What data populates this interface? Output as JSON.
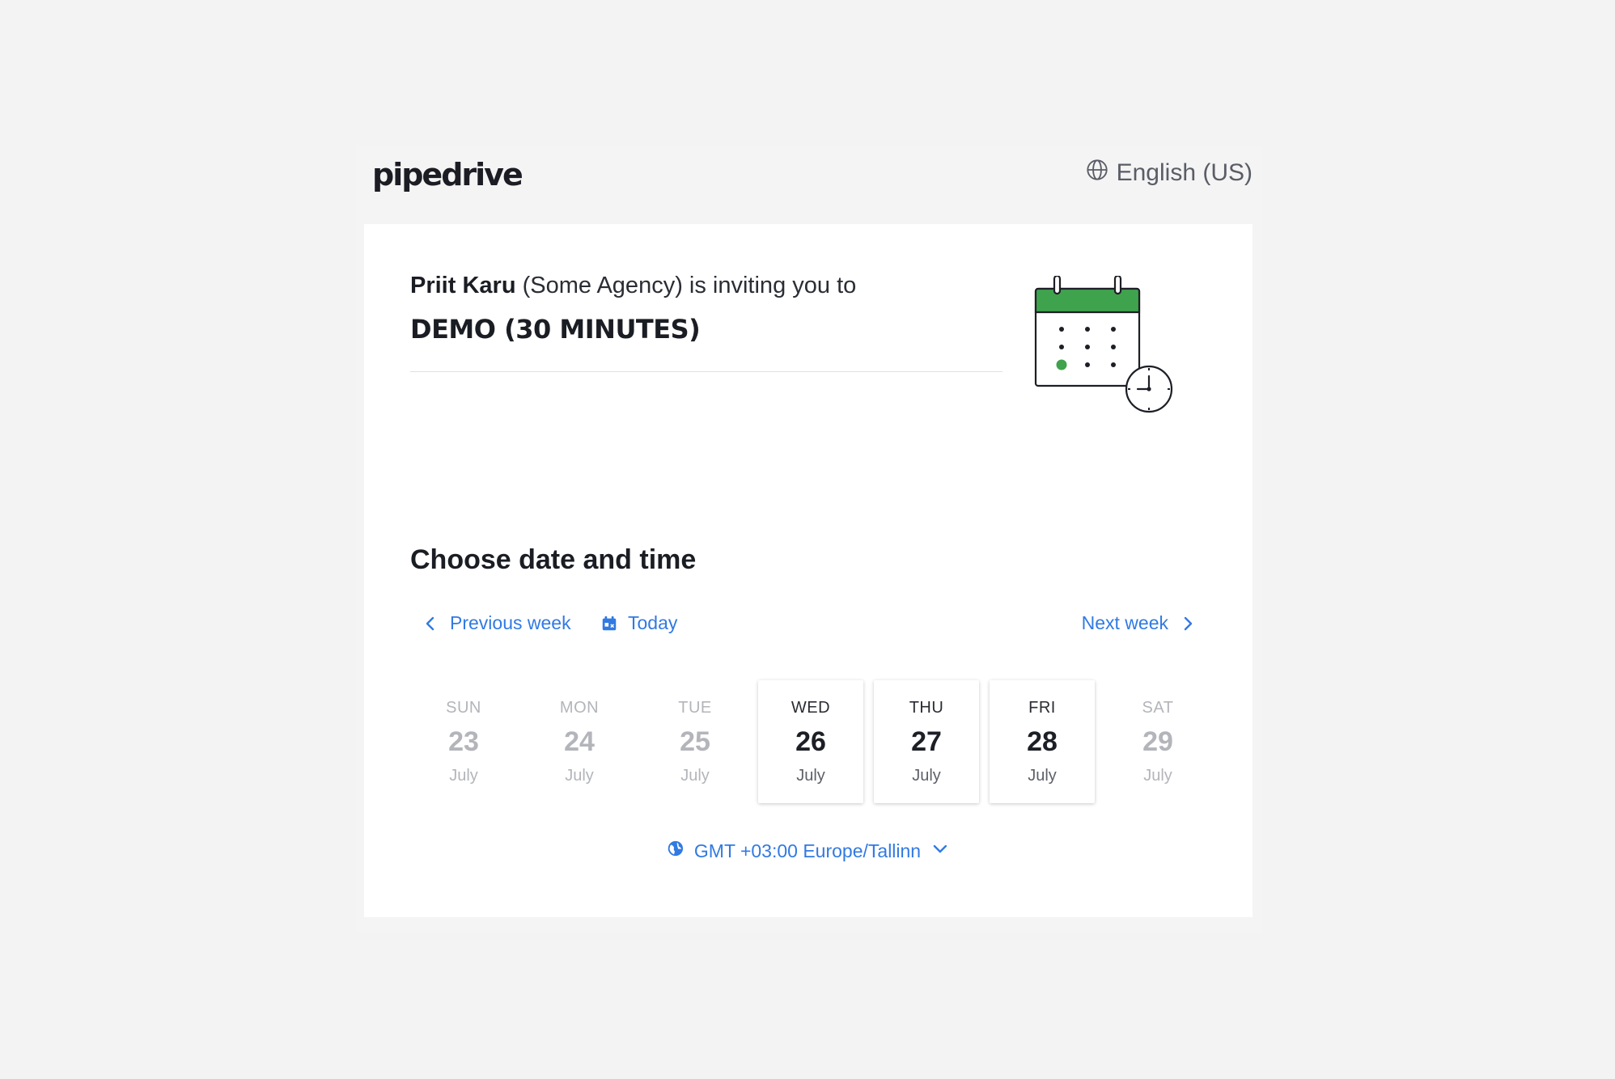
{
  "header": {
    "logo_text": "pipedrive",
    "language_label": "English (US)",
    "language_icon": "globe-icon"
  },
  "invite": {
    "host_name": "Priit Karu",
    "host_org": "(Some Agency)",
    "invite_text": "is inviting you to",
    "event_title": "DEMO (30 MINUTES)",
    "illustration_icon": "calendar-clock-icon",
    "accent_color": "#3fa34d"
  },
  "schedule": {
    "title": "Choose date and time",
    "prev_week_label": "Previous week",
    "today_label": "Today",
    "next_week_label": "Next week",
    "link_color": "#317ae2",
    "days": [
      {
        "name": "SUN",
        "number": "23",
        "month": "July",
        "available": false
      },
      {
        "name": "MON",
        "number": "24",
        "month": "July",
        "available": false
      },
      {
        "name": "TUE",
        "number": "25",
        "month": "July",
        "available": false
      },
      {
        "name": "WED",
        "number": "26",
        "month": "July",
        "available": true
      },
      {
        "name": "THU",
        "number": "27",
        "month": "July",
        "available": true
      },
      {
        "name": "FRI",
        "number": "28",
        "month": "July",
        "available": true
      },
      {
        "name": "SAT",
        "number": "29",
        "month": "July",
        "available": false
      }
    ],
    "timezone_label": "GMT +03:00 Europe/Tallinn"
  }
}
